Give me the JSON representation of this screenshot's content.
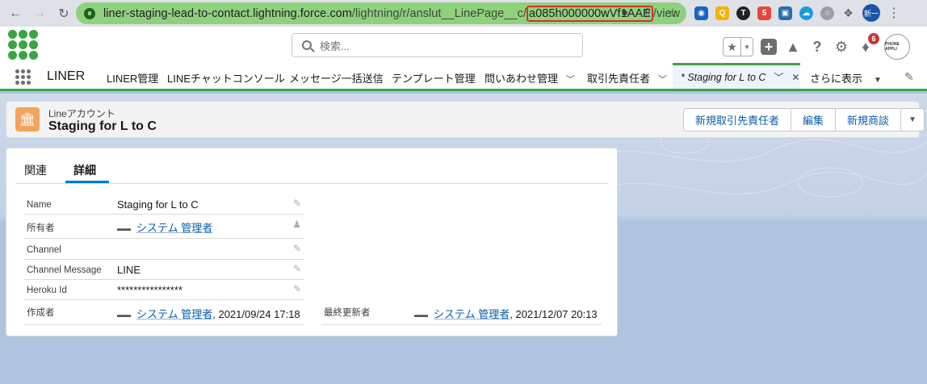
{
  "browser": {
    "url_main": "liner-staging-lead-to-contact.lightning.force.com",
    "url_path": "/lightning/r/anslut__LinePage__c/",
    "url_id": "a085h000000wVf1AAE",
    "url_tail": "/view",
    "profile_label": "新一"
  },
  "header": {
    "search_placeholder": "検索...",
    "notification_count": "6",
    "avatar_label": "PHONE APPLI"
  },
  "nav": {
    "app_name": "LINER",
    "items": [
      {
        "label": "LINER管理"
      },
      {
        "label": "LINEチャットコンソール"
      },
      {
        "label": "メッセージ一括送信"
      },
      {
        "label": "テンプレート管理"
      },
      {
        "label": "問いあわせ管理"
      },
      {
        "label": "取引先責任者"
      }
    ],
    "active_tab": "* Staging for L to C",
    "more": "さらに表示"
  },
  "record": {
    "object_type": "Lineアカウント",
    "title": "Staging for L to C",
    "actions": [
      "新規取引先責任者",
      "編集",
      "新規商談"
    ]
  },
  "tabs": {
    "related": "関連",
    "details": "詳細"
  },
  "fields": {
    "name_label": "Name",
    "name_value": "Staging for L to C",
    "owner_label": "所有者",
    "owner_value": "システム 管理者",
    "channel_label": "Channel",
    "channel_value": "",
    "channel_message_label": "Channel Message",
    "channel_message_value": "LINE",
    "heroku_label": "Heroku Id",
    "heroku_value": "****************",
    "created_label": "作成者",
    "created_user": "システム 管理者",
    "created_date": ", 2021/09/24 17:18",
    "modified_label": "最終更新者",
    "modified_user": "システム 管理者",
    "modified_date": ", 2021/12/07 20:13"
  }
}
